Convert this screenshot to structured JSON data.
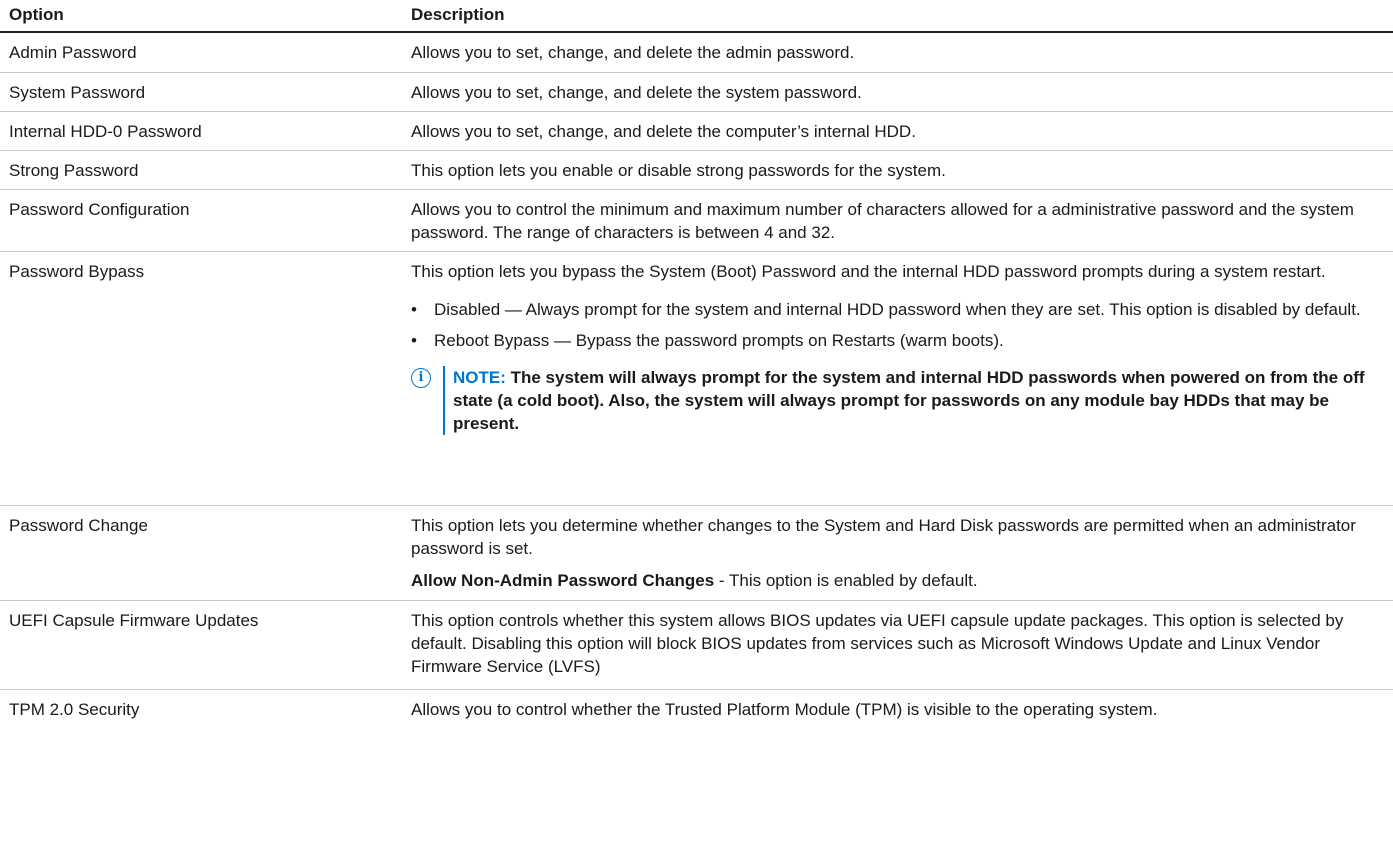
{
  "header": {
    "option": "Option",
    "description": "Description"
  },
  "rows": [
    {
      "option": "Admin Password",
      "description": "Allows you to set, change, and delete the admin password."
    },
    {
      "option": "System Password",
      "description": "Allows you to set, change, and delete the system password."
    },
    {
      "option": "Internal HDD-0 Password",
      "description": "Allows you to set, change, and delete the computer’s internal HDD."
    },
    {
      "option": "Strong Password",
      "description": "This option lets you enable or disable strong passwords for the system."
    },
    {
      "option": "Password Configuration",
      "description": "Allows you to control the minimum and maximum number of characters allowed for a administrative password and the system password. The range of characters is between 4 and 32."
    },
    {
      "option": "Password Bypass",
      "description": "This option lets you bypass the System (Boot) Password and the internal HDD password prompts during a system restart.",
      "bullets": [
        "Disabled — Always prompt for the system and internal HDD password when they are set. This option is disabled by default.",
        "Reboot Bypass — Bypass the password prompts on Restarts (warm boots)."
      ],
      "note_label": "NOTE:",
      "note_text": "The system will always prompt for the system and internal HDD passwords when powered on from the off state (a cold boot). Also, the system will always prompt for passwords on any module bay HDDs that may be present."
    },
    {
      "option": "Password Change",
      "description": "This option lets you determine whether changes to the System and Hard Disk passwords are permitted when an administrator password is set.",
      "setting_bold": "Allow Non-Admin Password Changes",
      "setting_rest": " - This option is enabled by default."
    },
    {
      "option": "UEFI Capsule Firmware Updates",
      "description": "This option controls whether this system allows BIOS updates via UEFI capsule update packages. This option is selected by default. Disabling this option will block BIOS updates from services such as Microsoft Windows Update and Linux Vendor Firmware Service (LVFS)"
    },
    {
      "option": "TPM 2.0 Security",
      "description": "Allows you to control whether the Trusted Platform Module (TPM) is visible to the operating system."
    }
  ],
  "bullet_glyph": "•",
  "icon": "info-icon",
  "accent_color": "#0076ce"
}
